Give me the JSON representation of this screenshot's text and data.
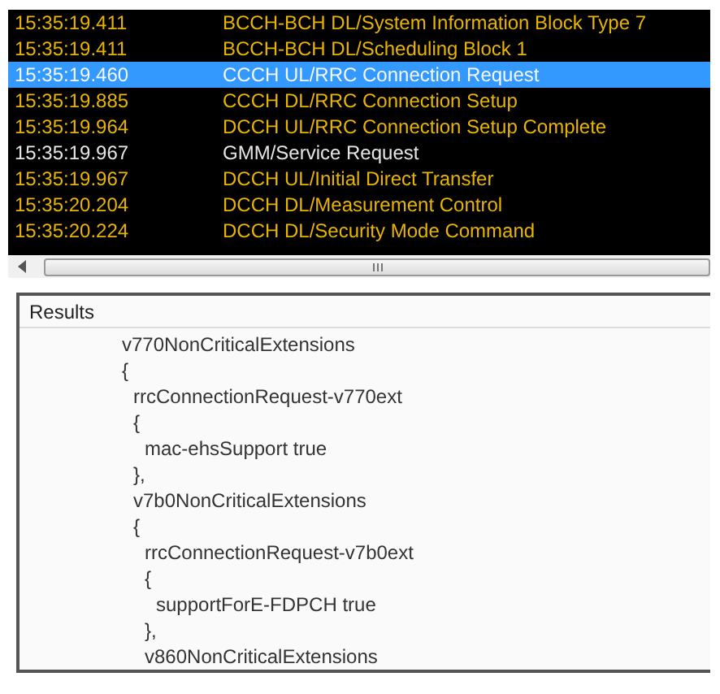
{
  "messages": [
    {
      "time": "15:35:19.411",
      "text": "BCCH-BCH DL/System Information Block Type 7",
      "color": "#e8b400",
      "selected": false
    },
    {
      "time": "15:35:19.411",
      "text": "BCCH-BCH DL/Scheduling Block 1",
      "color": "#e8b400",
      "selected": false
    },
    {
      "time": "15:35:19.460",
      "text": "CCCH UL/RRC Connection Request",
      "selected": true
    },
    {
      "time": "15:35:19.885",
      "text": "CCCH DL/RRC Connection Setup",
      "color": "#e8b400",
      "selected": false
    },
    {
      "time": "15:35:19.964",
      "text": "DCCH UL/RRC Connection Setup Complete",
      "color": "#e8b400",
      "selected": false
    },
    {
      "time": "15:35:19.967",
      "text": "GMM/Service Request",
      "color": "#e6e6e6",
      "selected": false
    },
    {
      "time": "15:35:19.967",
      "text": "DCCH UL/Initial Direct Transfer",
      "color": "#e8b400",
      "selected": false
    },
    {
      "time": "15:35:20.204",
      "text": "DCCH DL/Measurement Control",
      "color": "#e8b400",
      "selected": false
    },
    {
      "time": "15:35:20.224",
      "text": "DCCH DL/Security Mode Command",
      "color": "#e8b400",
      "selected": false
    }
  ],
  "results": {
    "title": "Results",
    "lines": [
      {
        "text": "v770NonCriticalExtensions"
      },
      {
        "text": "{",
        "children": [
          {
            "text": "rrcConnectionRequest-v770ext"
          },
          {
            "text": "{",
            "children": [
              {
                "text": "mac-ehsSupport true"
              }
            ]
          },
          {
            "text": "},"
          },
          {
            "text": "v7b0NonCriticalExtensions"
          },
          {
            "text": "{",
            "children": [
              {
                "text": "rrcConnectionRequest-v7b0ext"
              },
              {
                "text": "{",
                "children": [
                  {
                    "text": "supportForE-FDPCH true"
                  }
                ]
              },
              {
                "text": "},"
              },
              {
                "text": "v860NonCriticalExtensions"
              }
            ]
          }
        ]
      }
    ]
  }
}
